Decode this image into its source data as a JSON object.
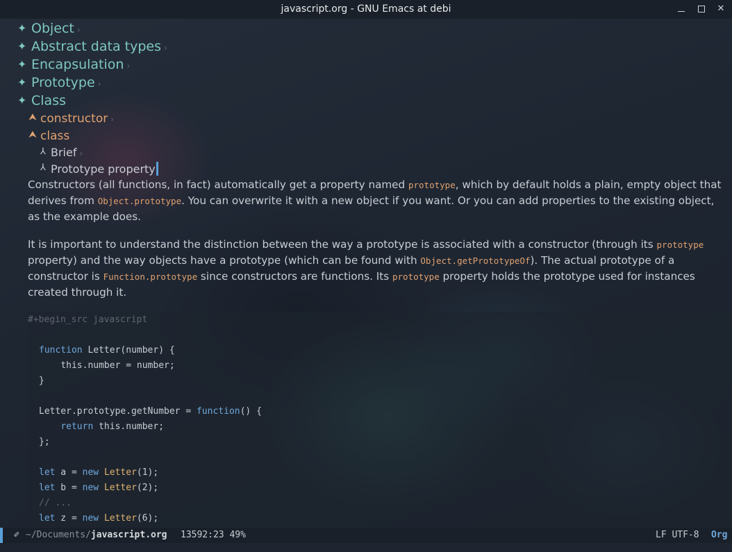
{
  "window": {
    "title": "javascript.org - GNU Emacs at debi",
    "minimize_icon": "minimize-icon",
    "maximize_icon": "maximize-icon",
    "close_glyph": "✕"
  },
  "outline": {
    "level1": [
      {
        "bullet": "✦",
        "label": "Object",
        "folded": true
      },
      {
        "bullet": "✦",
        "label": "Abstract data types",
        "folded": true
      },
      {
        "bullet": "✦",
        "label": "Encapsulation",
        "folded": true
      },
      {
        "bullet": "✦",
        "label": "Prototype",
        "folded": true
      },
      {
        "bullet": "✦",
        "label": "Class",
        "folded": false
      }
    ],
    "level2": [
      {
        "bullet": "⮝",
        "label": "constructor",
        "folded": true
      },
      {
        "bullet": "⮝",
        "label": "class",
        "folded": false
      }
    ],
    "level3": [
      {
        "bullet": "⅄",
        "label": "Brief",
        "folded": true
      },
      {
        "bullet": "⅄",
        "label": "Prototype property",
        "folded": false
      }
    ],
    "fold_marker": "›"
  },
  "paragraphs": {
    "p1": {
      "t1": "Constructors (all functions, in fact) automatically get a property named ",
      "c1": "prototype",
      "t2": ", which by default holds a plain, empty object that derives from ",
      "c2": "Object.prototype",
      "t3": ". You can overwrite it with a new object if you want. Or you can add properties to the existing object, as the example does."
    },
    "p2": {
      "t1": "It is important to understand the distinction between the way a prototype is associated with a constructor (through its ",
      "c1": "prototype",
      "t2": " property) and the way objects have a prototype (which can be found with ",
      "c2": "Object.getPrototypeOf",
      "t3": "). The actual prototype of a constructor is ",
      "c3": "Function.prototype",
      "t4": " since constructors are functions. Its ",
      "c4": "prototype",
      "t5": " property holds the prototype used for instances created through it."
    }
  },
  "src_block": {
    "header": "#+begin_src javascript",
    "language": "javascript",
    "lines": [
      "function Letter(number) {",
      "    this.number = number;",
      "}",
      "",
      "Letter.prototype.getNumber = function() {",
      "    return this.number;",
      "};",
      "",
      "let a = new Letter(1);",
      "let b = new Letter(2);",
      "// ...",
      "let z = new Letter(6);"
    ]
  },
  "modeline": {
    "icon": "emacs-icon",
    "path_dir": "~/Documents/",
    "path_file": "javascript.org",
    "position": "13592:23 49%",
    "encoding": "LF UTF-8",
    "mode": "Org"
  },
  "colors": {
    "heading1": "#7ec7c1",
    "heading2": "#e1a270",
    "keyword": "#6fa8dc",
    "inline_code": "#e1a270",
    "cursor": "#5aa0d8",
    "background": "#1e2530"
  }
}
